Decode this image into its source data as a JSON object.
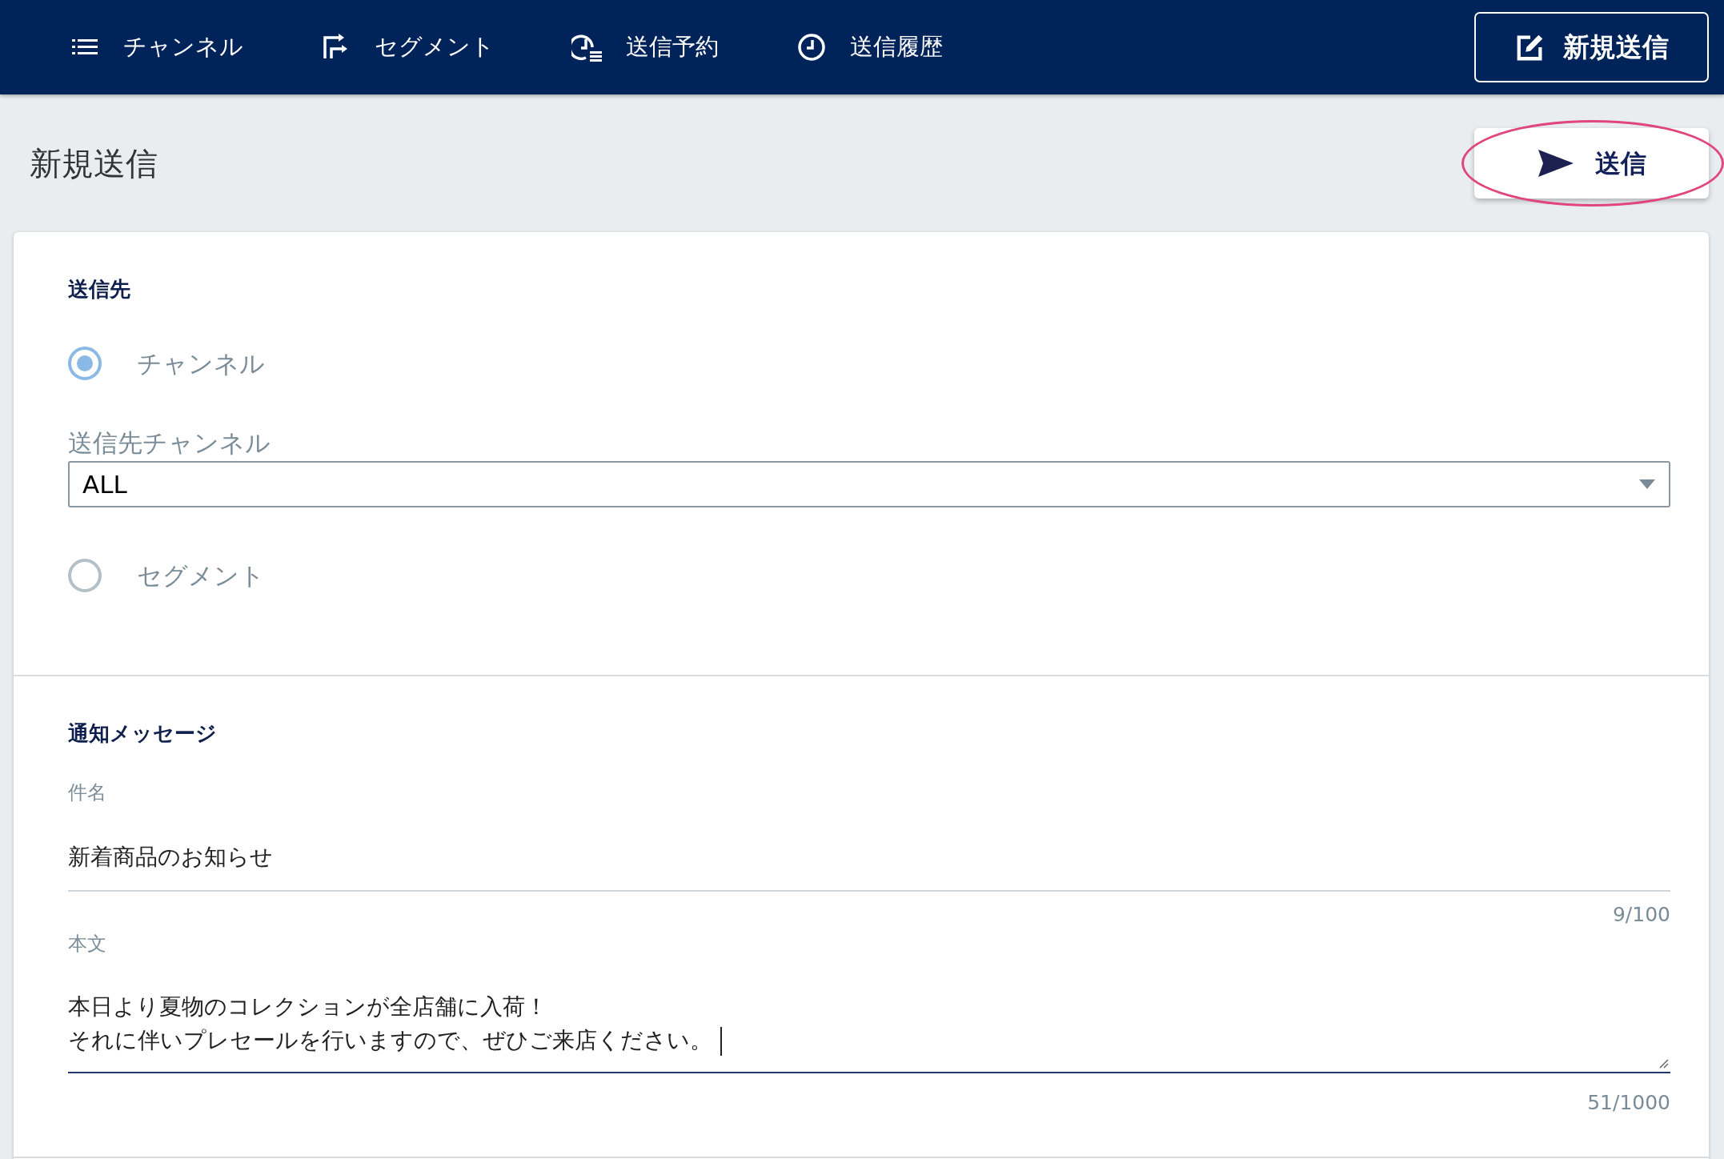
{
  "nav": {
    "items": [
      {
        "label": "チャンネル",
        "kind": "list"
      },
      {
        "label": "セグメント",
        "kind": "segment"
      },
      {
        "label": "送信予約",
        "kind": "schedule"
      },
      {
        "label": "送信履歴",
        "kind": "history"
      }
    ],
    "new_button": "新規送信"
  },
  "page": {
    "title": "新規送信",
    "send_button": {
      "label": "送信",
      "highlighted": true
    }
  },
  "recipient": {
    "heading": "送信先",
    "options": [
      {
        "label": "チャンネル",
        "selected": true
      },
      {
        "label": "セグメント",
        "selected": false
      }
    ],
    "channel_select": {
      "label": "送信先チャンネル",
      "value": "ALL"
    }
  },
  "message": {
    "heading": "通知メッセージ",
    "subject": {
      "label": "件名",
      "value": "新着商品のお知らせ",
      "counter": "9/100"
    },
    "body": {
      "label": "本文",
      "lines": [
        "本日より夏物のコレクションが全店舗に入荷！",
        "それに伴いプレセールを行いますので、ぜひご来店ください。"
      ],
      "counter": "51/1000",
      "focused": true
    }
  }
}
